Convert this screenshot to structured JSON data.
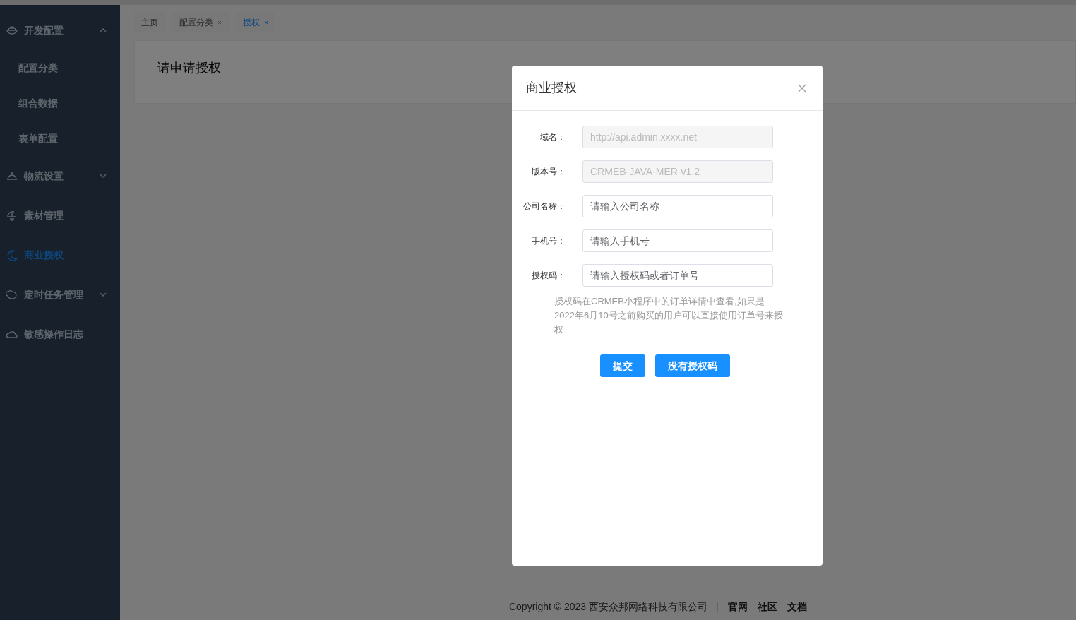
{
  "sidebar": {
    "items": [
      {
        "label": "开发配置",
        "expanded": true,
        "selected": false,
        "children": [
          {
            "label": "配置分类",
            "selected": false
          },
          {
            "label": "组合数据",
            "selected": false
          },
          {
            "label": "表单配置",
            "selected": false
          }
        ]
      },
      {
        "label": "物流设置",
        "expanded": false,
        "selected": false
      },
      {
        "label": "素材管理",
        "selected": false
      },
      {
        "label": "商业授权",
        "selected": true
      },
      {
        "label": "定时任务管理",
        "expanded": false,
        "selected": false
      },
      {
        "label": "敏感操作日志",
        "selected": false
      }
    ]
  },
  "tabs": [
    {
      "label": "主页",
      "selected": false,
      "closable": false
    },
    {
      "label": "配置分类",
      "selected": false,
      "closable": true
    },
    {
      "label": "授权",
      "selected": true,
      "closable": true
    }
  ],
  "page": {
    "heading": "请申请授权"
  },
  "dialog": {
    "title": "商业授权",
    "fields": [
      {
        "label": "域名：",
        "value": "http://api.admin.xxxx.net",
        "disabled": true
      },
      {
        "label": "版本号：",
        "value": "CRMEB-JAVA-MER-v1.2",
        "disabled": true
      },
      {
        "label": "公司名称：",
        "placeholder": "请输入公司名称",
        "disabled": false
      },
      {
        "label": "手机号：",
        "placeholder": "请输入手机号",
        "disabled": false
      },
      {
        "label": "授权码：",
        "placeholder": "请输入授权码或者订单号",
        "disabled": false
      }
    ],
    "hint": "授权码在CRMEB小程序中的订单详情中查看,如果是2022年6月10号之前购买的用户可以直接使用订单号来授权",
    "buttons": [
      "提交",
      "没有授权码"
    ]
  },
  "footer": {
    "copyright": "Copyright © 2023 西安众邦网络科技有限公司",
    "links": [
      "官网",
      "社区",
      "文档"
    ]
  }
}
